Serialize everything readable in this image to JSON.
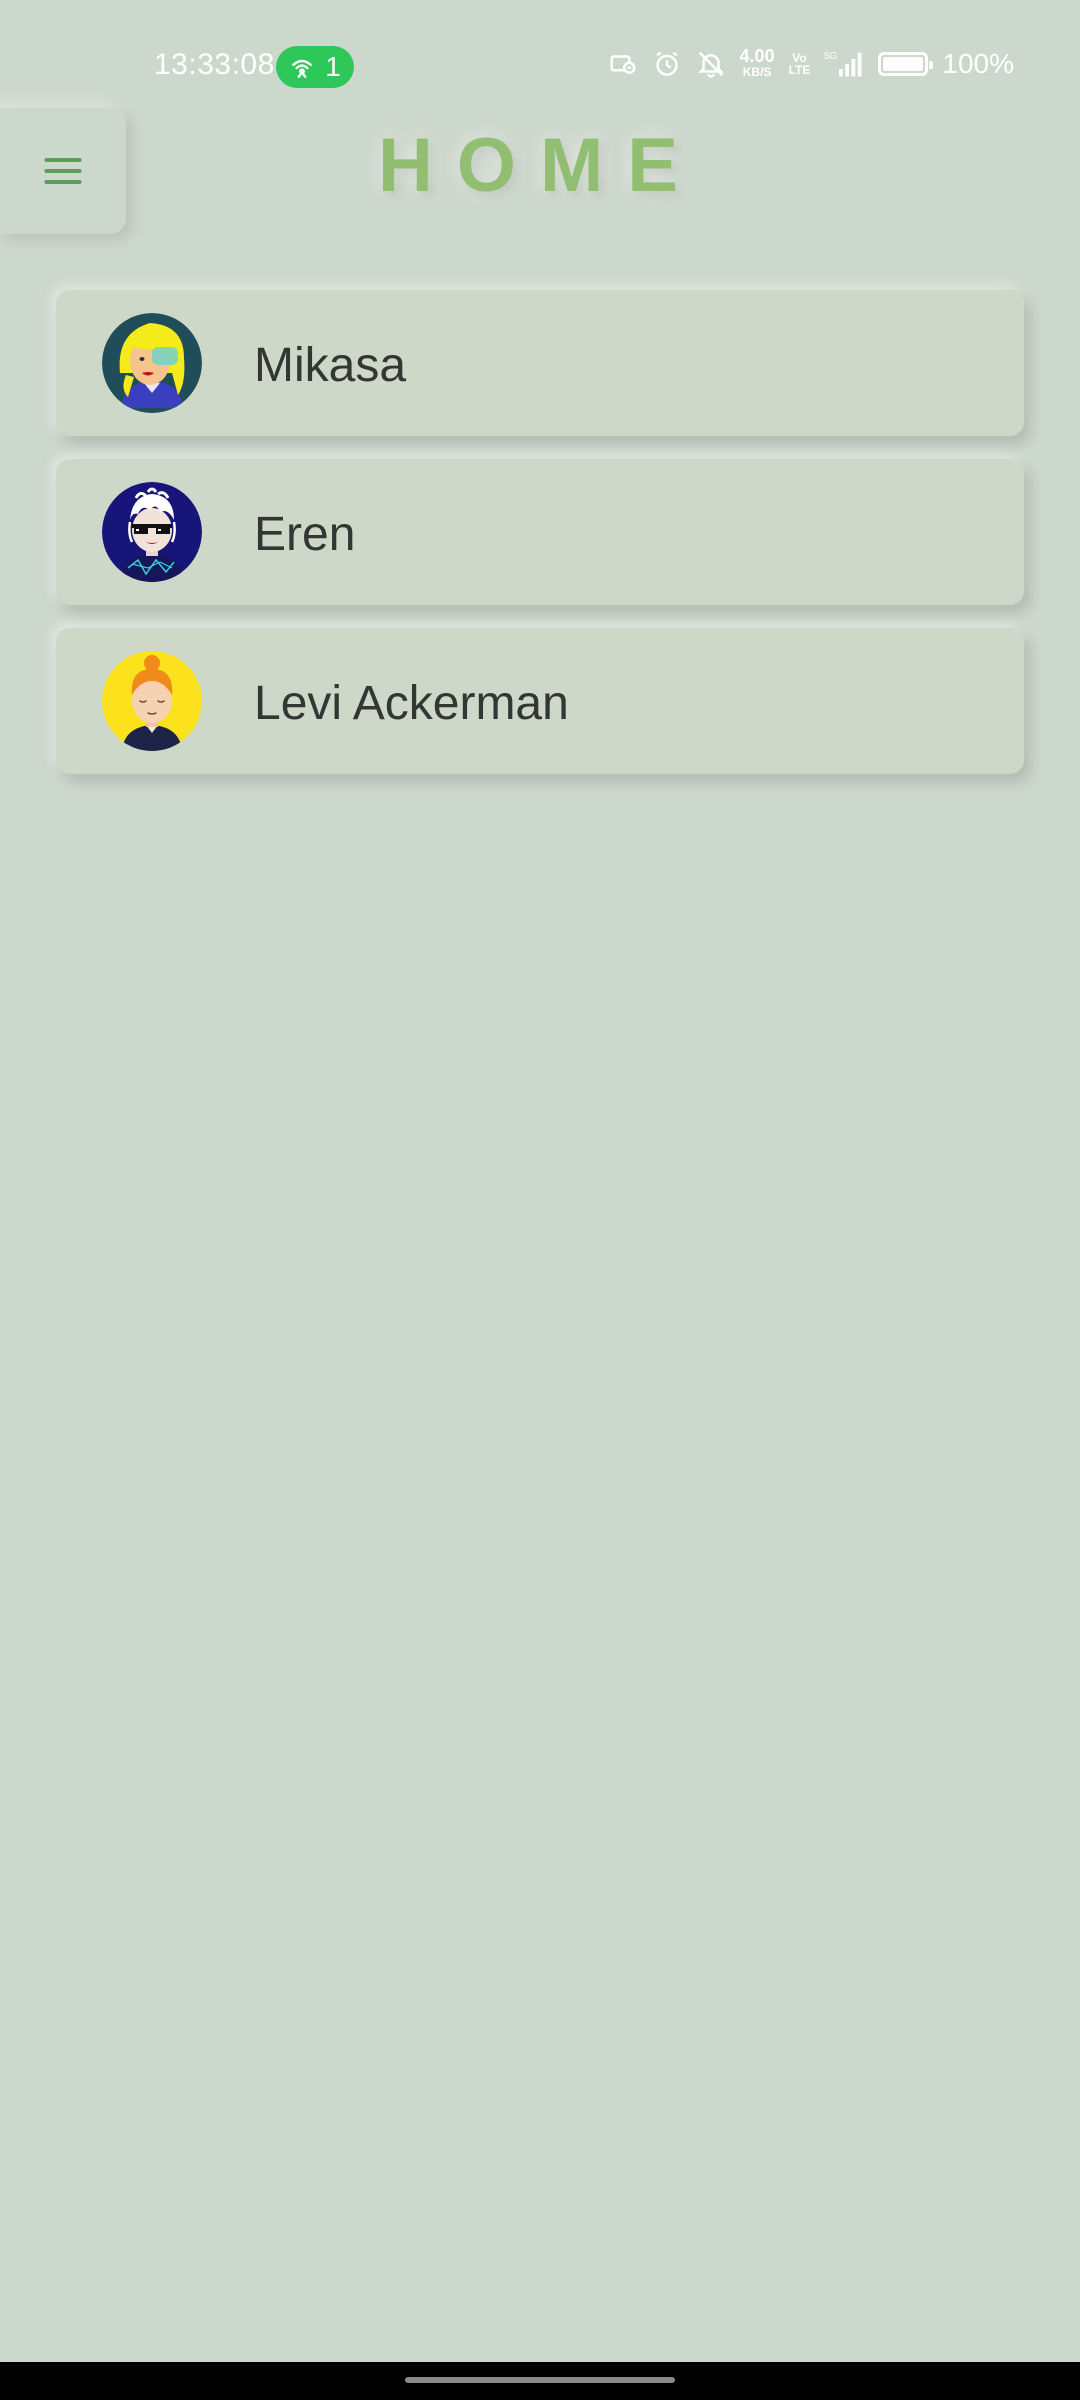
{
  "status_bar": {
    "time": "13:33:08",
    "hotspot_count": "1",
    "net_speed_value": "4.00",
    "net_speed_unit": "KB/S",
    "volte_top": "Vo",
    "volte_bottom": "LTE",
    "signal_label": "5G",
    "battery_level": 100,
    "battery_text": "100%",
    "icons": [
      "hotspot-icon",
      "cast-icon",
      "alarm-icon",
      "mute-icon",
      "signal-icon",
      "battery-icon"
    ],
    "colors": {
      "hotspot_pill": "#2EC75A",
      "text": "#FFFFFF"
    }
  },
  "header": {
    "title": "HOME",
    "menu_icon": "hamburger-menu-icon",
    "colors": {
      "title": "#91BE70",
      "menu_icon": "#5A9E5A",
      "background": "#CDD8CC"
    }
  },
  "contacts": [
    {
      "name": "Mikasa",
      "avatar_icon": "avatar-blonde-woman"
    },
    {
      "name": "Eren",
      "avatar_icon": "avatar-pixel-sunglasses"
    },
    {
      "name": "Levi Ackerman",
      "avatar_icon": "avatar-orange-hair-bun"
    }
  ]
}
